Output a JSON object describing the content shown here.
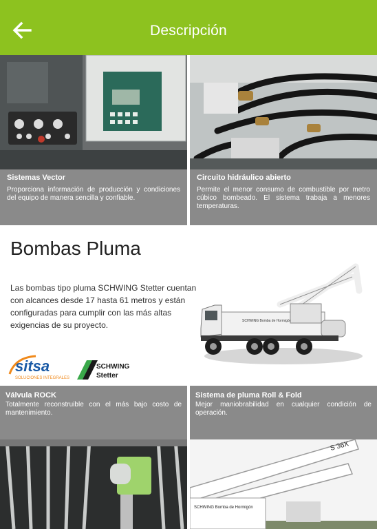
{
  "header": {
    "title": "Descripción"
  },
  "features_top": [
    {
      "title": "Sistemas Vector",
      "text": "Proporciona información de producción y condiciones del equipo de manera sencilla y confiable."
    },
    {
      "title": "Circuito hidráulico abierto",
      "text": "Permite el menor consumo de combustible por metro cúbico bombeado. El sistema trabaja a menores temperaturas."
    }
  ],
  "section": {
    "title": "Bombas Pluma",
    "intro": "Las bombas tipo pluma SCHWING Stetter cuentan con alcances desde 17 hasta 61 metros y están configuradas para cumplir con las más altas exigencias de su proyecto.",
    "truck_text": "SCHWING Bomba de Hormigón",
    "logos": {
      "sitsa": "sitsa",
      "sitsa_tag": "SOLUCIONES INTEGRALES",
      "schwing": "SCHWING",
      "stetter": "Stetter"
    }
  },
  "features_bottom": [
    {
      "title": "Válvula ROCK",
      "text": "Totalmente reconstruible con el más bajo costo de mantenimiento."
    },
    {
      "title": "Sistema de pluma Roll & Fold",
      "text": "Mejor maniobrabilidad en cualquier condición de operación."
    }
  ],
  "bottom_photo": {
    "truck_text": "SCHWING Bomba de Hormigón",
    "boom_text": "S 36X"
  },
  "colors": {
    "accent": "#8dc21f",
    "panel": "#8a8a8a",
    "sitsa_orange": "#f08a1c",
    "sitsa_blue": "#1a5aa6"
  }
}
